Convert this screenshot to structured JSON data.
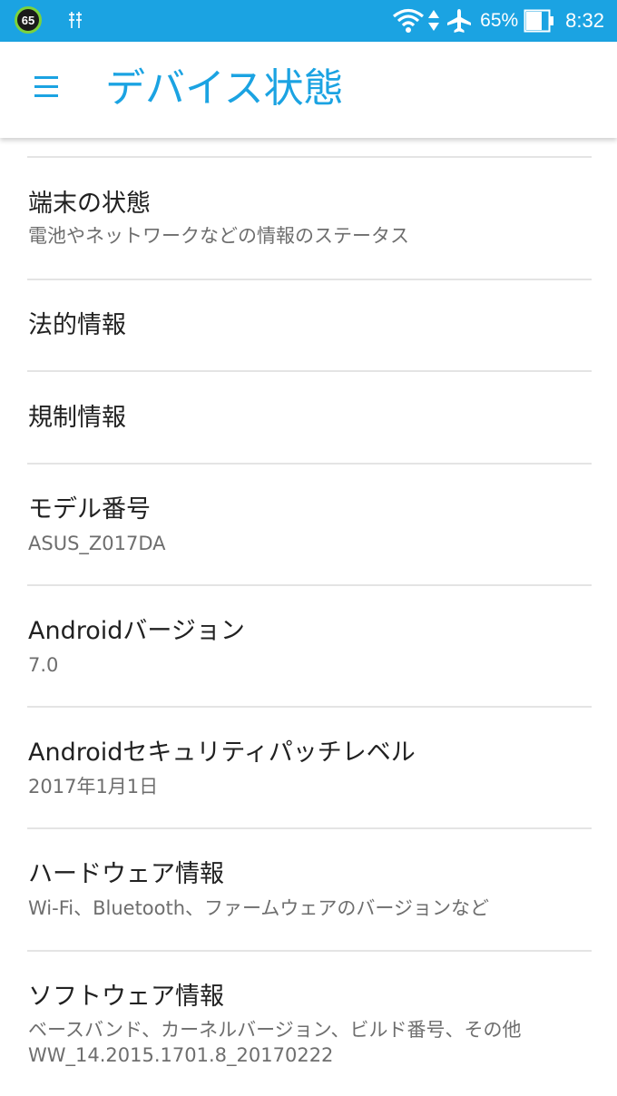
{
  "status_bar": {
    "notification_badge": "65",
    "battery_percent": "65%",
    "time": "8:32",
    "icons": [
      "usb-debug-icon",
      "wifi-icon",
      "data-arrows-icon",
      "airplane-icon",
      "battery-icon"
    ]
  },
  "app_bar": {
    "title": "デバイス状態",
    "menu_icon": "hamburger-menu-icon",
    "accent_color": "#1ba3e2"
  },
  "items": [
    {
      "title": "端末の状態",
      "subtitle": "電池やネットワークなどの情報のステータス"
    },
    {
      "title": "法的情報"
    },
    {
      "title": "規制情報"
    },
    {
      "title": "モデル番号",
      "subtitle": "ASUS_Z017DA"
    },
    {
      "title": "Androidバージョン",
      "subtitle": "7.0"
    },
    {
      "title": "Androidセキュリティパッチレベル",
      "subtitle": "2017年1月1日"
    },
    {
      "title": "ハードウェア情報",
      "subtitle": "Wi-Fi、Bluetooth、ファームウェアのバージョンなど"
    },
    {
      "title": "ソフトウェア情報",
      "subtitle": "ベースバンド、カーネルバージョン、ビルド番号、その他",
      "subtitle2": "WW_14.2015.1701.8_20170222"
    }
  ]
}
